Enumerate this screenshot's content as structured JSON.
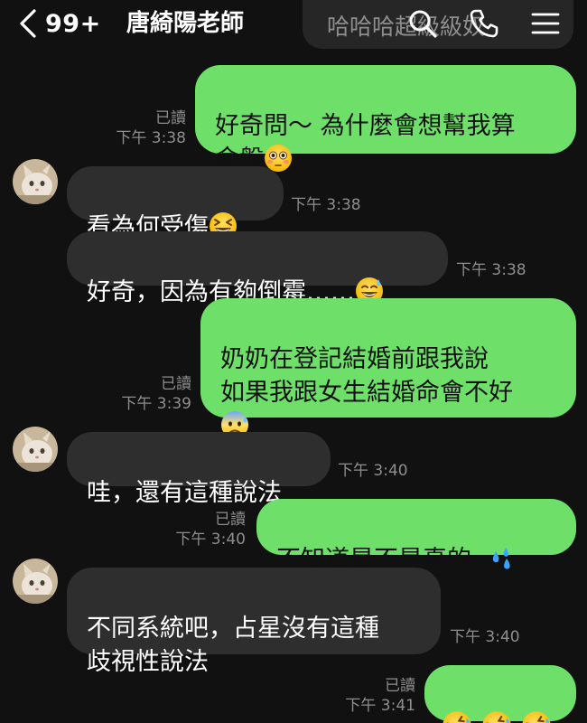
{
  "header": {
    "unread_count": "99+",
    "chat_title": "唐綺陽老師",
    "pinned_preview": "哈哈哈超級級奴"
  },
  "messages": [
    {
      "dir": "sent",
      "text": "好奇問～ 為什麼會想幫我算\n命盤",
      "emoji": [
        "flushed-emoji"
      ],
      "read": "已讀",
      "time": "下午 3:38"
    },
    {
      "dir": "recv",
      "text": "看為何受傷",
      "emoji": [
        "grinning-squinting-emoji"
      ],
      "time": "下午 3:38"
    },
    {
      "dir": "recv",
      "text": "好奇，因為有夠倒霉……",
      "emoji": [
        "sweat-smile-emoji"
      ],
      "time": "下午 3:38"
    },
    {
      "dir": "sent",
      "text": "奶奶在登記結婚前跟我說\n如果我跟女生結婚命會不好",
      "emoji": [
        "anxious-sweat-emoji"
      ],
      "read": "已讀",
      "time": "下午 3:39"
    },
    {
      "dir": "recv",
      "text": "哇，還有這種說法",
      "emoji": [],
      "time": "下午 3:40"
    },
    {
      "dir": "sent",
      "text": "不知道是不是真的..",
      "emoji": [
        "sweat-droplets-emoji"
      ],
      "read": "已讀",
      "time": "下午 3:40"
    },
    {
      "dir": "recv",
      "text": "不同系統吧，占星沒有這種\n歧視性說法",
      "emoji": [],
      "time": "下午 3:40"
    },
    {
      "dir": "sent",
      "text": "",
      "emoji": [
        "rofl-emoji",
        "rofl-emoji",
        "rofl-emoji"
      ],
      "read": "已讀",
      "time": "下午 3:41"
    }
  ],
  "colors": {
    "background": "#111111",
    "sent_bubble": "#6ee06a",
    "received_bubble": "#2e2e2e",
    "meta_text": "#8e8e8e"
  }
}
